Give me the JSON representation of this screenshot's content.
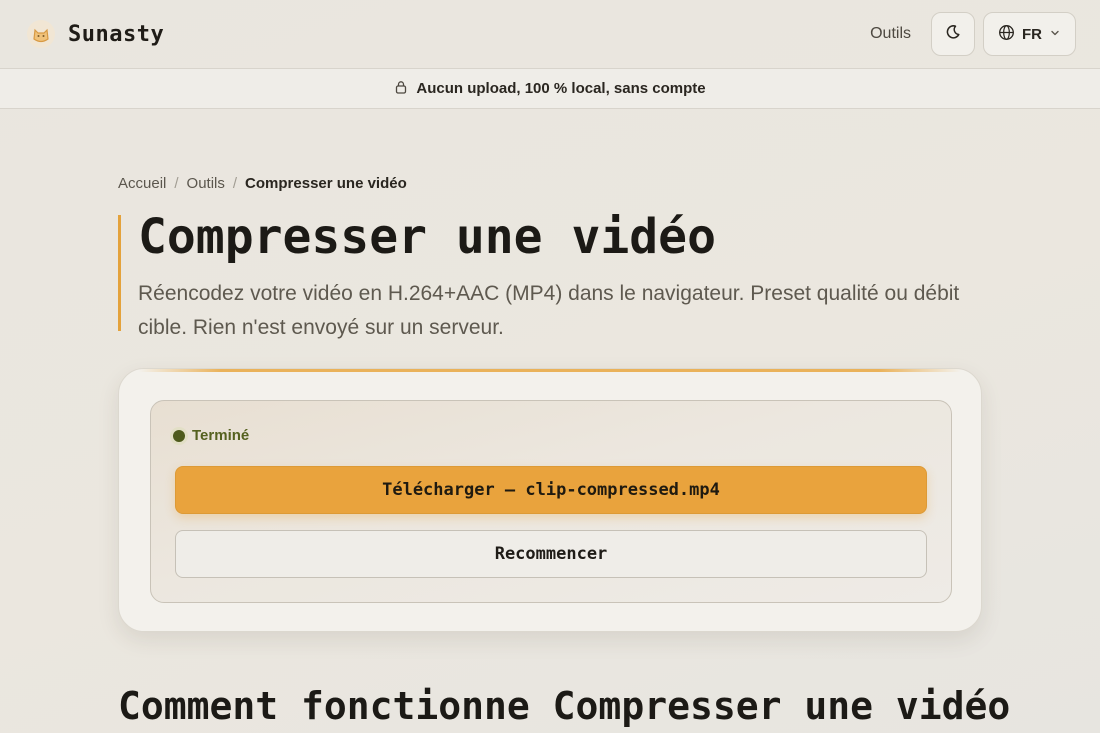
{
  "header": {
    "brand": "Sunasty",
    "nav_tools": "Outils",
    "language": "FR"
  },
  "banner": {
    "text": "Aucun upload, 100 % local, sans compte"
  },
  "breadcrumb": {
    "home": "Accueil",
    "tools": "Outils",
    "current": "Compresser une vidéo"
  },
  "hero": {
    "title": "Compresser une vidéo",
    "subtitle": "Réencodez votre vidéo en H.264+AAC (MP4) dans le navigateur. Preset qualité ou débit cible. Rien n'est envoyé sur un serveur."
  },
  "result": {
    "status": "Terminé",
    "download_label": "Télécharger — clip-compressed.mp4",
    "restart_label": "Recommencer"
  },
  "section": {
    "how_title": "Comment fonctionne Compresser une vidéo"
  },
  "icons": {
    "logo": "cat-logo-icon",
    "theme": "moon-icon",
    "language": "globe-icon",
    "dropdown": "chevron-down-icon",
    "banner": "lock-icon"
  },
  "colors": {
    "accent": "#e9a33d",
    "status": "#55611f"
  }
}
